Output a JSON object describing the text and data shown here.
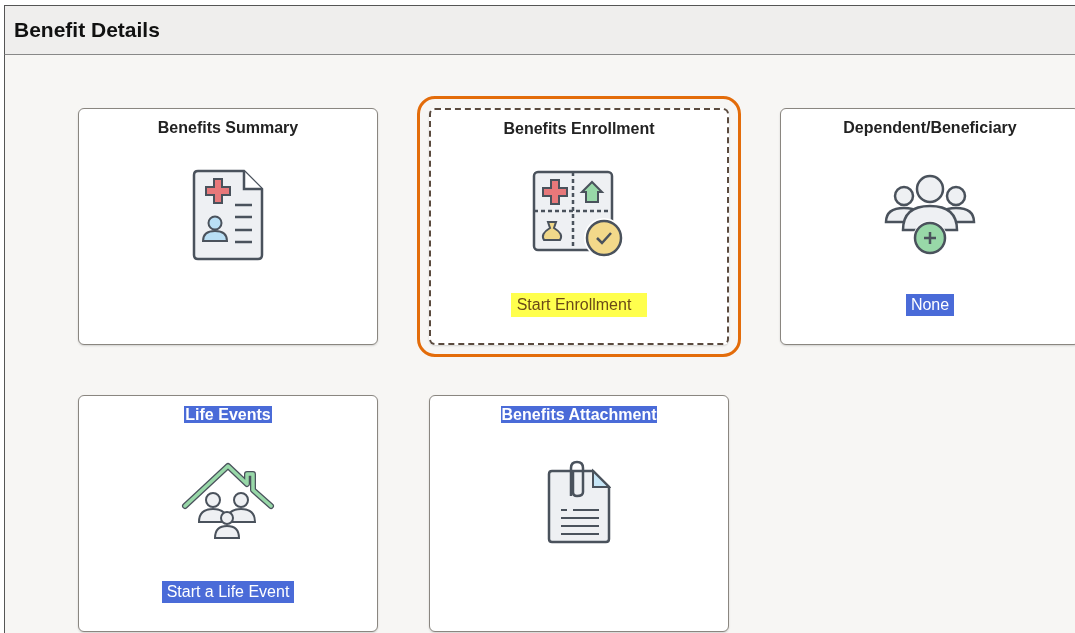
{
  "page": {
    "title": "Benefit Details"
  },
  "tiles": [
    {
      "title": {
        "text": "Benefits Summary",
        "selected": false
      },
      "kind": "summary",
      "focused": false
    },
    {
      "title": {
        "text": "Benefits Enrollment",
        "selected": false
      },
      "kind": "enrollment",
      "focused": true,
      "status": {
        "text": "Start Enrollment",
        "selected": false,
        "highlighted": true
      }
    },
    {
      "title": {
        "text": "Dependent/Beneficiary",
        "selected": false
      },
      "kind": "dependents",
      "focused": false,
      "status": {
        "text": "None",
        "selected": true,
        "highlighted": false
      }
    },
    {
      "title": {
        "text": "Life Events",
        "selected": true
      },
      "kind": "life-events",
      "focused": false,
      "status": {
        "text": "Start a Life Event",
        "selected": true,
        "highlighted": false
      }
    },
    {
      "title": {
        "text": "Benefits Attachment",
        "selected": true
      },
      "kind": "attachment",
      "focused": false
    }
  ]
}
